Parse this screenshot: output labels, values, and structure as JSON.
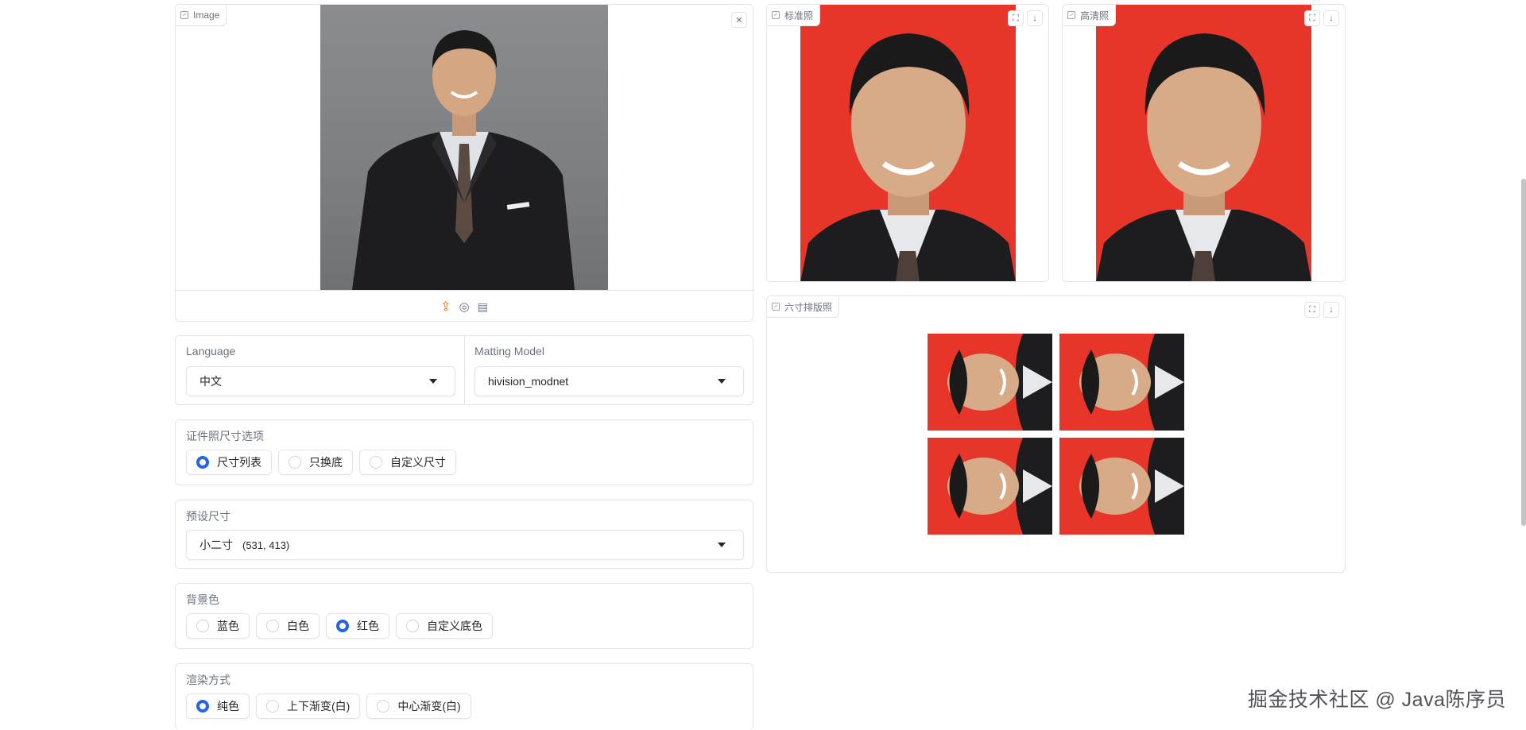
{
  "image_input": {
    "label": "Image",
    "close_icon": "close-icon",
    "source_icons": [
      "upload-icon",
      "webcam-icon",
      "clipboard-icon"
    ],
    "image_description_bg": "#808285"
  },
  "language": {
    "label": "Language",
    "value": "中文"
  },
  "matting_model": {
    "label": "Matting Model",
    "value": "hivision_modnet"
  },
  "size_option": {
    "label": "证件照尺寸选项",
    "options": [
      "尺寸列表",
      "只换底",
      "自定义尺寸"
    ],
    "selected": 0
  },
  "preset_size": {
    "label": "预设尺寸",
    "value_name": "小二寸",
    "value_dims": "(531, 413)"
  },
  "background_color": {
    "label": "背景色",
    "options": [
      "蓝色",
      "白色",
      "红色",
      "自定义底色"
    ],
    "selected": 2
  },
  "render_mode": {
    "label": "渲染方式",
    "options": [
      "纯色",
      "上下渐变(白)",
      "中心渐变(白)"
    ],
    "selected": 0
  },
  "outputs": {
    "standard_label": "标准照",
    "hd_label": "高清照",
    "layout_label": "六寸排版照",
    "fullscreen_icon": "fullscreen-icon",
    "download_icon": "download-icon"
  },
  "colors": {
    "accent": "#2563eb",
    "photo_red": "#e8352a",
    "upload_orange": "#f97316"
  },
  "watermark": "掘金技术社区 @ Java陈序员"
}
